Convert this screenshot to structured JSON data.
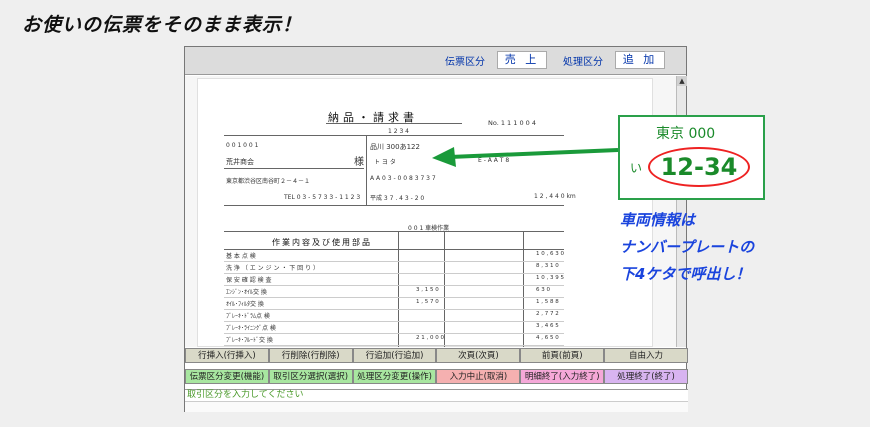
{
  "headline": "お使いの伝票をそのまま表示！",
  "topbar": {
    "slip_label": "伝票区分",
    "slip_value": "売 上",
    "proc_label": "処理区分",
    "proc_value": "追 加"
  },
  "doc": {
    "title": "納品・請求書",
    "no": "No. 1 1 1 0 0 4",
    "code": "1 2 3 4",
    "cust_code": "0 0 1 0 0 1",
    "customer": "荒井商会",
    "sama": "様",
    "address": "東京都渋谷区南谷町２－４－１",
    "tel": "TEL 0 3 - 5 7 3 3 - 1 1 2 3",
    "plate_no": "品川 300あ122",
    "car_name": "ト ヨ タ",
    "model": "E - A A T 8",
    "chassis": "A A 0 3 - 0 0 8 3 7 3 7",
    "date": "平成 3 7 . 4 3 - 2 0",
    "mileage": "1 2 , 4 4 0  km",
    "work": "0 0 1 車検作業",
    "table_header": "作業内容及び使用部品",
    "items": [
      {
        "name": "基 本 点 検",
        "amount": "1 0 , 6 3 0",
        "price": ""
      },
      {
        "name": "洗 浄 （ エ ン ジ ン ・ 下 回 り ）",
        "amount": "8 , 3 1 0",
        "price": ""
      },
      {
        "name": "保 安 確 認 検 査",
        "amount": "1 0 , 3 9 5",
        "price": ""
      },
      {
        "name": "ｴﾝｼﾞﾝ･ｵｲﾙ交 換",
        "amount": "6 3 0",
        "price": "3 , 1 5 0"
      },
      {
        "name": "ｵｲﾙ･ﾌｨﾙﾀ交 換",
        "amount": "1 , 5 8 8",
        "price": "1 , 5 7 0"
      },
      {
        "name": "ﾌﾞﾚｰｷ･ﾄﾞﾗﾑ点 検",
        "amount": "2 , 7 7 2",
        "price": ""
      },
      {
        "name": "ﾌﾞﾚｰｷ･ﾗｲﾆﾝｸﾞ点 検",
        "amount": "3 , 4 6 5",
        "price": ""
      },
      {
        "name": "ﾌﾞﾚｰｷ･ﾌﾙｰﾄﾞ交 換",
        "amount": "4 , 6 5 0",
        "price": "2 1 , 0 0 0"
      }
    ]
  },
  "buttons_row1": [
    "行挿入(行挿入)",
    "行削除(行削除)",
    "行追加(行追加)",
    "次頁(次頁)",
    "前頁(前頁)",
    "自由入力"
  ],
  "buttons_row2": [
    "伝票区分変更(機能)",
    "取引区分選択(選択)",
    "処理区分変更(操作)",
    "入力中止(取消)",
    "明細終了(入力終了)",
    "処理終了(終了)"
  ],
  "row2_colors": [
    "#a8e6a0",
    "#a8e6a0",
    "#a8e6a0",
    "#f5b0b0",
    "#f5a8d8",
    "#d8b4f0"
  ],
  "status_text": "取引区分を入力してください",
  "plate": {
    "region": "東京 000",
    "kana": "い",
    "number": "12-34"
  },
  "note_lines": [
    "車両情報は",
    "ナンバープレートの",
    "下4ケタで呼出し！"
  ]
}
